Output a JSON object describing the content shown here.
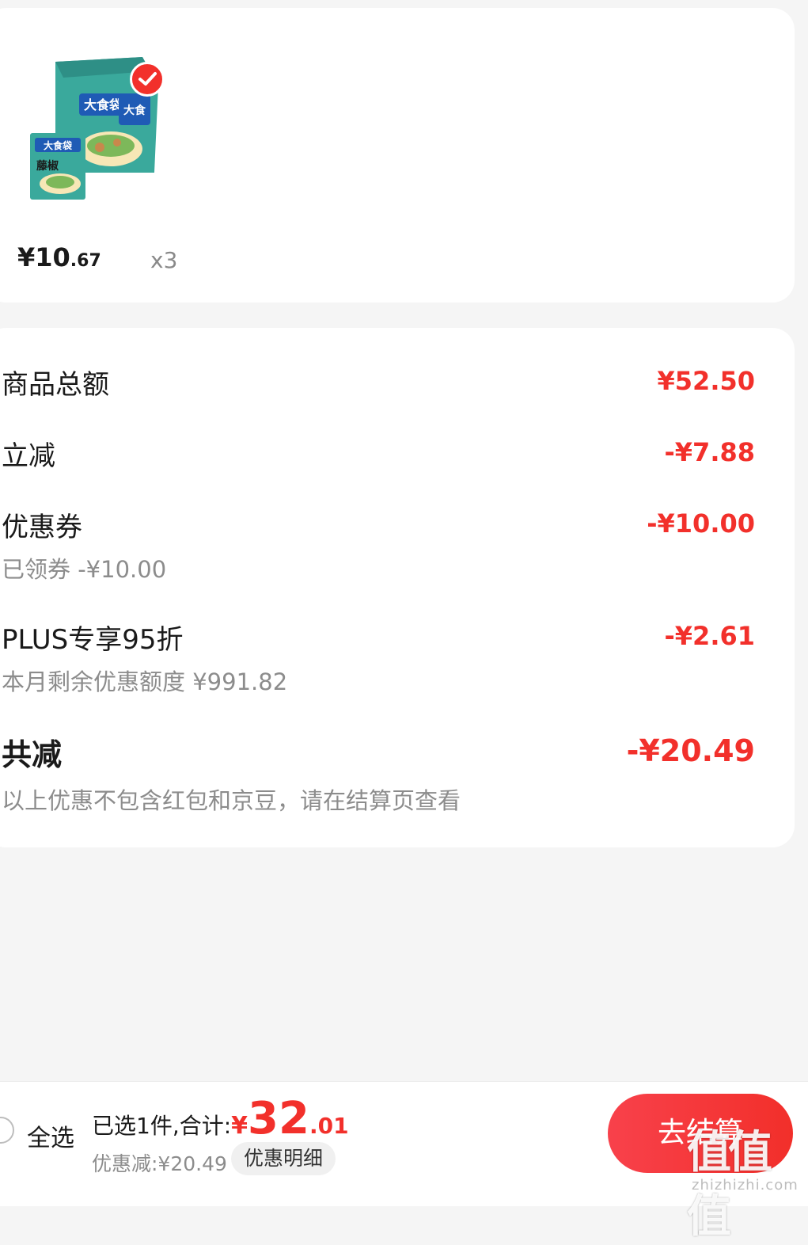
{
  "product": {
    "price_currency": "¥",
    "price_int": "10",
    "price_dec": ".67",
    "quantity": "x3",
    "image_icon": "instant-noodle-pack-icon",
    "selected_icon": "check-circle-icon"
  },
  "discounts": {
    "goods_total_label": "商品总额",
    "goods_total_value": "¥52.50",
    "instant_cut_label": "立减",
    "instant_cut_value": "-¥7.88",
    "coupon_label": "优惠券",
    "coupon_value": "-¥10.00",
    "coupon_sub": "已领券 -¥10.00",
    "plus_label": "PLUS专享95折",
    "plus_value": "-¥2.61",
    "plus_sub": "本月剩余优惠额度 ¥991.82",
    "total_cut_label": "共减",
    "total_cut_value": "-¥20.49",
    "note": "以上优惠不包含红包和京豆，请在结算页查看"
  },
  "bottom_bar": {
    "select_all": "全选",
    "selected_text": "已选1件,合计:",
    "total_currency": "¥",
    "total_int": "32",
    "total_dec": ".01",
    "discount_text": "优惠减:¥20.49",
    "detail_button": "优惠明细",
    "checkout_button": "去结算"
  },
  "watermark": {
    "big": "值值值",
    "small": "zhizhizhi.com"
  },
  "colors": {
    "accent": "#f2302b",
    "background": "#f5f5f5",
    "card": "#ffffff",
    "muted_text": "#8c8c8c"
  }
}
